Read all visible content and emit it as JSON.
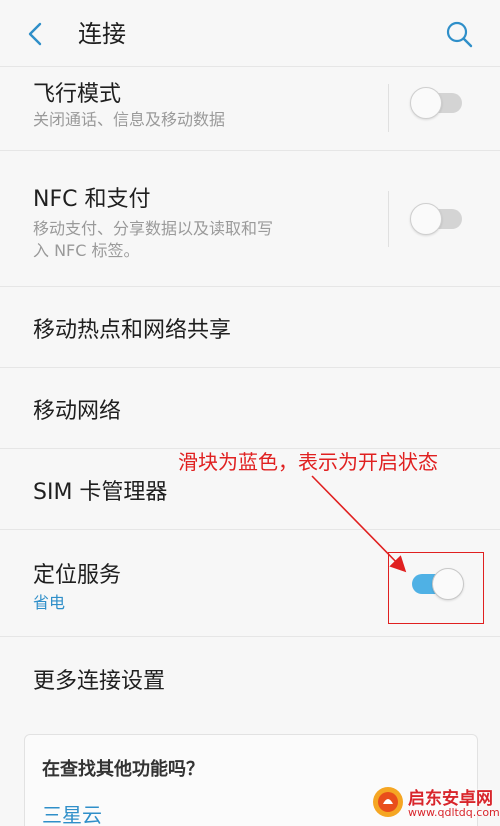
{
  "header": {
    "title": "连接",
    "back_icon": "back-arrow-icon",
    "search_icon": "search-icon"
  },
  "items": [
    {
      "title": "飞行模式",
      "subtitle": "关闭通话、信息及移动数据",
      "toggle": "off"
    },
    {
      "title": "NFC 和支付",
      "subtitle_lines": [
        "移动支付、分享数据以及读取和写",
        "入 NFC 标签。"
      ],
      "toggle": "off"
    },
    {
      "title": "移动热点和网络共享"
    },
    {
      "title": "移动网络"
    },
    {
      "title": "SIM 卡管理器"
    },
    {
      "title": "定位服务",
      "subtitle": "省电",
      "toggle": "on"
    },
    {
      "title": "更多连接设置"
    }
  ],
  "annotation": {
    "text": "滑块为蓝色，表示为开启状态",
    "color": "#e02020"
  },
  "card": {
    "title": "在查找其他功能吗？",
    "link": "三星云"
  },
  "watermark": {
    "title": "启东安卓网",
    "url": "www.qdltdq.com"
  },
  "colors": {
    "accent": "#2f8fc9",
    "toggle_on": "#4fb1e5",
    "toggle_off": "#d4d4d4",
    "annotation": "#e02020"
  }
}
